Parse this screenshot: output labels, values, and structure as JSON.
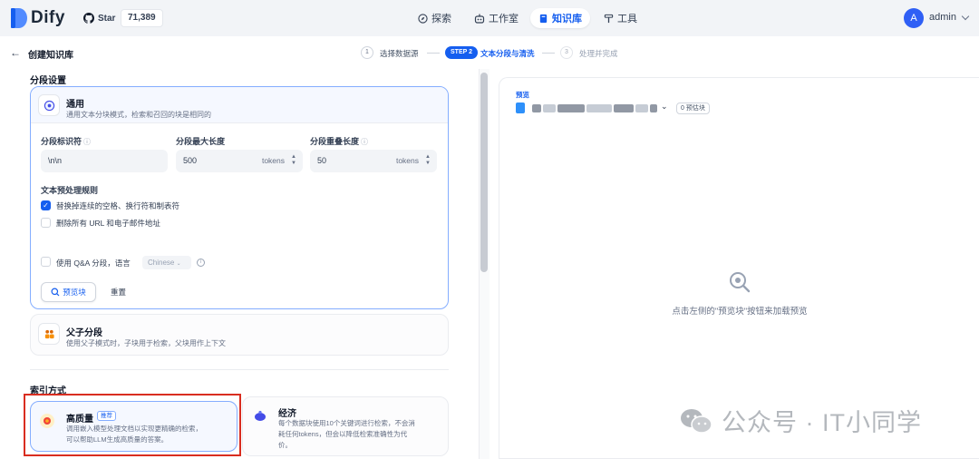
{
  "app": {
    "name": "Dify"
  },
  "github": {
    "star_label": "Star",
    "star_count": "71,389"
  },
  "nav": {
    "items": [
      {
        "label": "探索",
        "icon": "compass-icon"
      },
      {
        "label": "工作室",
        "icon": "robot-icon"
      },
      {
        "label": "知识库",
        "icon": "book-icon",
        "active": true
      },
      {
        "label": "工具",
        "icon": "hammer-icon"
      }
    ]
  },
  "user": {
    "initial": "A",
    "name": "admin"
  },
  "page": {
    "title": "创建知识库"
  },
  "steps": [
    {
      "num": "1",
      "label": "选择数据源"
    },
    {
      "pill": "STEP 2",
      "label": "文本分段与清洗",
      "active": true
    },
    {
      "num": "3",
      "label": "处理并完成"
    }
  ],
  "segment": {
    "section_title": "分段设置",
    "general": {
      "title": "通用",
      "desc": "通用文本分块模式，检索和召回的块是相同的",
      "separator_label": "分段标识符",
      "separator_value": "\\n\\n",
      "max_len_label": "分段最大长度",
      "max_len_value": "500",
      "overlap_label": "分段重叠长度",
      "overlap_value": "50",
      "unit": "tokens",
      "rules_title": "文本预处理规则",
      "rule_1": "替换掉连续的空格、换行符和制表符",
      "rule_1_checked": true,
      "rule_2": "删除所有 URL 和电子邮件地址",
      "rule_2_checked": false,
      "qa_label": "使用 Q&A 分段，语言",
      "qa_checked": false,
      "qa_lang": "Chinese",
      "preview_btn": "预览块",
      "reset_btn": "重置"
    },
    "parent_child": {
      "title": "父子分段",
      "desc": "使用父子模式时，子块用于检索，父块用作上下文"
    }
  },
  "index": {
    "section_title": "索引方式",
    "high_quality": {
      "title": "高质量",
      "tag": "推荐",
      "desc_1": "调用嵌入模型处理文档以实现更精确的检索，",
      "desc_2": "可以帮助LLM生成高质量的答案。"
    },
    "economy": {
      "title": "经济",
      "desc_1": "每个数据块使用10个关键词进行检索，不会消",
      "desc_2": "耗任何tokens，但会以降低检索准确性为代",
      "desc_3": "价。"
    }
  },
  "preview": {
    "label": "预览",
    "chunk_count": "0 预估块",
    "empty_text": "点击左侧的\"预览块\"按钮来加载预览"
  },
  "watermark": {
    "text": "公众号 · IT小同学"
  },
  "colors": {
    "accent": "#155eef",
    "highlight": "#d92d20"
  }
}
